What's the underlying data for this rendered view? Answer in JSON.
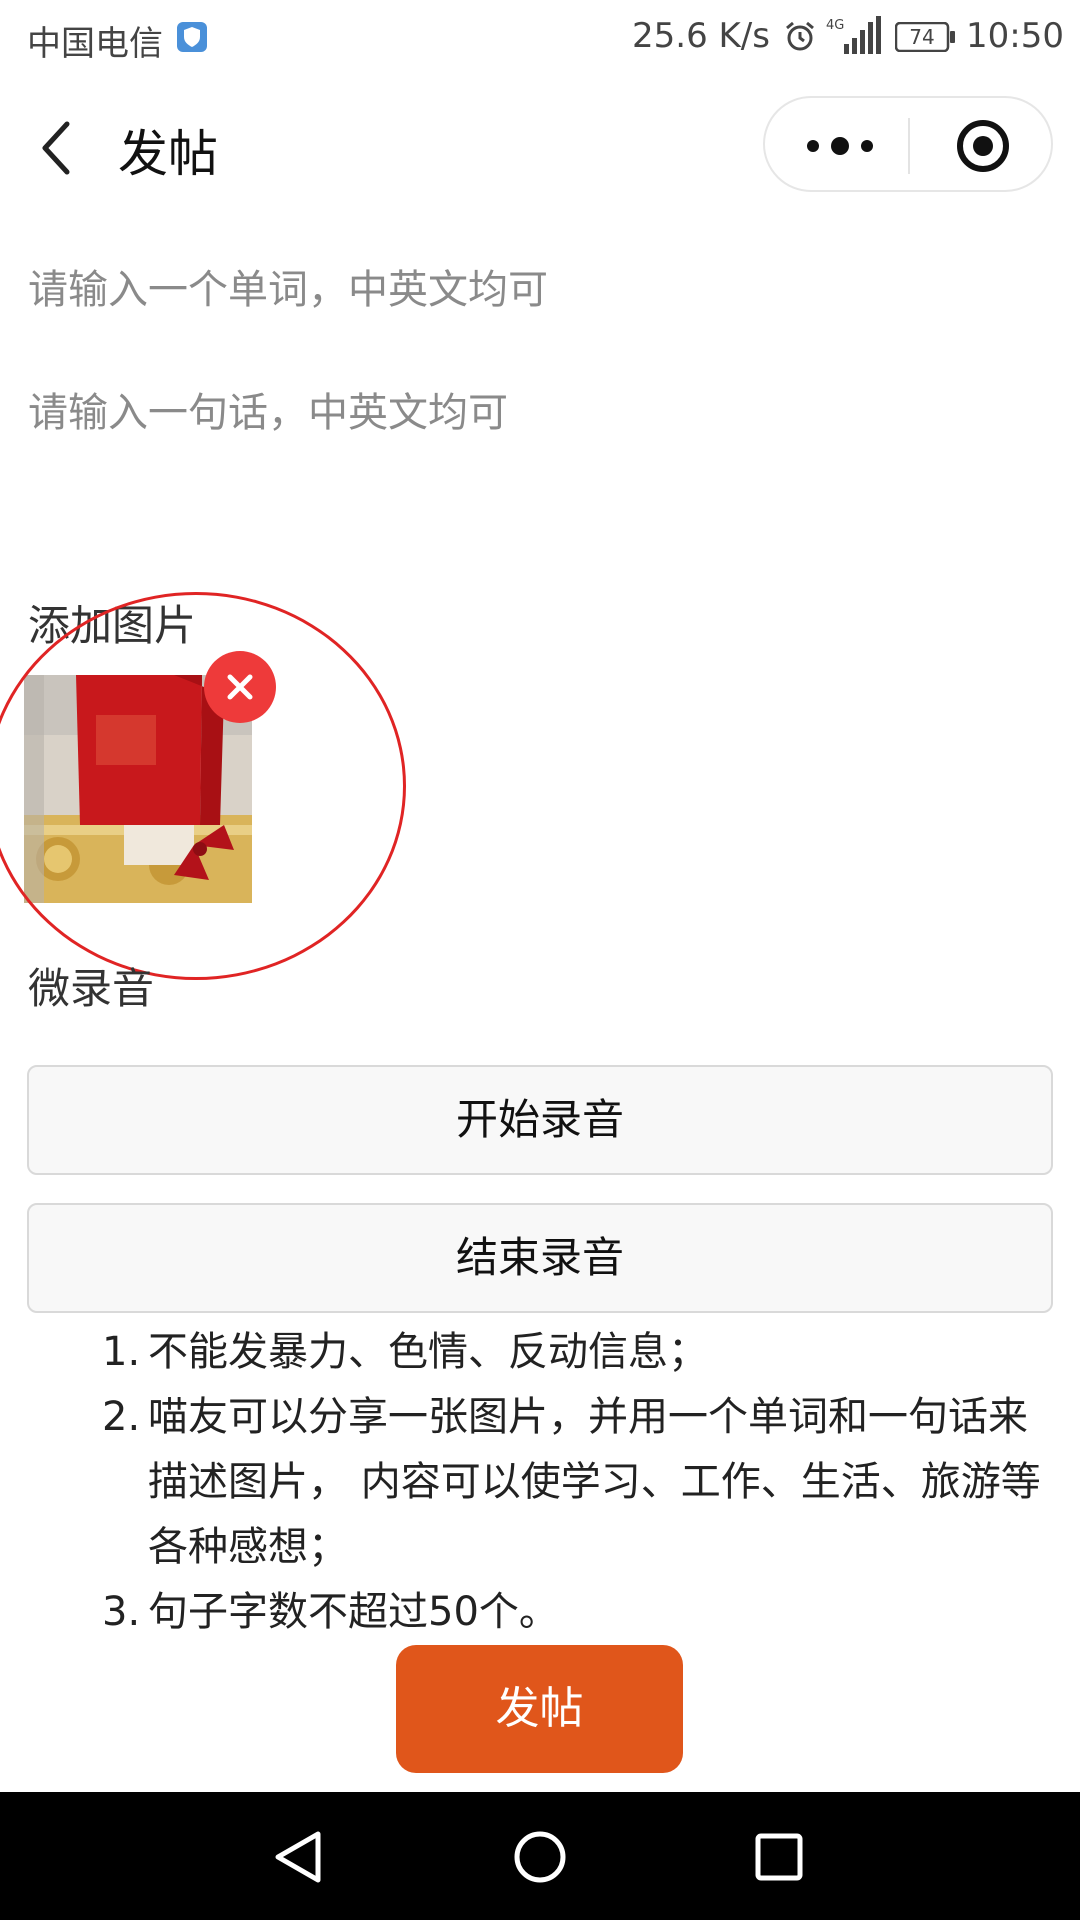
{
  "status_bar": {
    "carrier": "中国电信",
    "net_speed": "25.6 K/s",
    "network_type": "4G",
    "battery_level": "74",
    "time": "10:50"
  },
  "nav": {
    "title": "发帖"
  },
  "form": {
    "word_placeholder": "请输入一个单词，中英文均可",
    "word_value": "",
    "sentence_placeholder": "请输入一句话，中英文均可",
    "sentence_value": "",
    "add_image_label": "添加图片",
    "record_label": "微录音",
    "start_record_label": "开始录音",
    "stop_record_label": "结束录音"
  },
  "rules": [
    {
      "num": "1.",
      "text": "不能发暴力、色情、反动信息；"
    },
    {
      "num": "2.",
      "text": "喵友可以分享一张图片，并用一个单词和一句话来描述图片， 内容可以使学习、工作、生活、旅游等各种感想；"
    },
    {
      "num": "3.",
      "text": "句子字数不超过50个。"
    }
  ],
  "post_button_label": "发帖",
  "colors": {
    "accent": "#e0561b",
    "remove_badge": "#ee3a3a",
    "highlight_circle": "#e02424",
    "system_nav_bg": "#000000"
  },
  "icons": {
    "back": "chevron-left-icon",
    "more": "more-dots-icon",
    "close_capsule": "target-circle-icon",
    "remove_image": "close-icon",
    "sys_back": "triangle-back-icon",
    "sys_home": "circle-home-icon",
    "sys_recents": "square-recents-icon"
  }
}
